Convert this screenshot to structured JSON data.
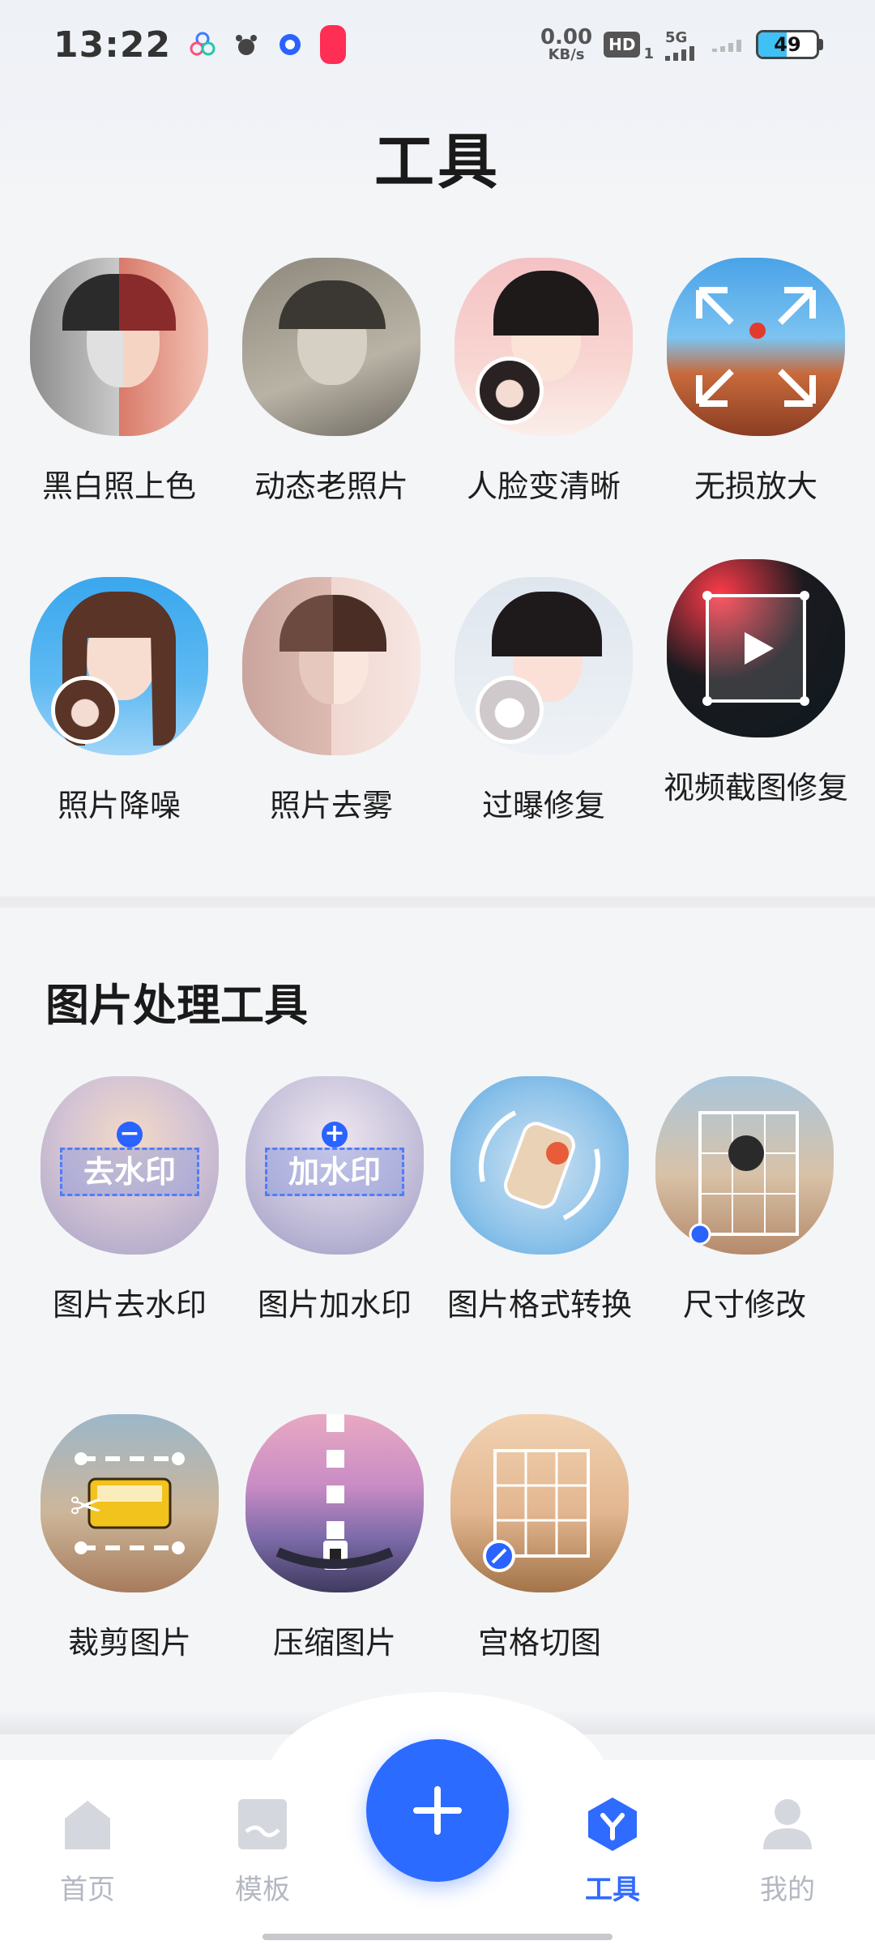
{
  "status_bar": {
    "time": "13:22",
    "net_speed_value": "0.00",
    "net_speed_unit": "KB/s",
    "hd_label": "HD",
    "hd_sub": "1",
    "network_label": "5G",
    "battery_level": "49",
    "battery_fraction": 0.49,
    "icons": [
      "flower-app-icon",
      "paw-app-icon",
      "target-app-icon",
      "screen-record-icon",
      "signal-icon"
    ]
  },
  "header": {
    "title": "工具"
  },
  "repair_section": {
    "tools": [
      {
        "label": "黑白照上色",
        "icon": "colorize-thumbnail"
      },
      {
        "label": "动态老照片",
        "icon": "animate-photo-thumbnail"
      },
      {
        "label": "人脸变清晰",
        "icon": "face-enhance-thumbnail"
      },
      {
        "label": "无损放大",
        "icon": "upscale-thumbnail"
      },
      {
        "label": "照片降噪",
        "icon": "denoise-thumbnail"
      },
      {
        "label": "照片去雾",
        "icon": "dehaze-thumbnail"
      },
      {
        "label": "过曝修复",
        "icon": "overexposure-thumbnail"
      },
      {
        "label": "视频截图修复",
        "icon": "video-frame-thumbnail"
      }
    ]
  },
  "processing_section": {
    "title": "图片处理工具",
    "tools": [
      {
        "label": "图片去水印",
        "overlay": "去水印",
        "icon": "remove-watermark-thumbnail"
      },
      {
        "label": "图片加水印",
        "overlay": "加水印",
        "icon": "add-watermark-thumbnail"
      },
      {
        "label": "图片格式转换",
        "icon": "format-convert-thumbnail"
      },
      {
        "label": "尺寸修改",
        "icon": "resize-thumbnail"
      },
      {
        "label": "裁剪图片",
        "icon": "crop-thumbnail"
      },
      {
        "label": "压缩图片",
        "icon": "compress-thumbnail"
      },
      {
        "label": "宫格切图",
        "icon": "grid-cut-thumbnail"
      }
    ]
  },
  "bottom_nav": {
    "items": [
      {
        "label": "首页",
        "icon": "home-icon",
        "active": false
      },
      {
        "label": "模板",
        "icon": "template-icon",
        "active": false
      },
      {
        "label": "工具",
        "icon": "tools-icon",
        "active": true
      },
      {
        "label": "我的",
        "icon": "profile-icon",
        "active": false
      }
    ],
    "fab_icon": "plus-icon"
  },
  "colors": {
    "accent": "#2b6bff",
    "nav_inactive": "#b3b8c2",
    "background": "#f4f5f7"
  }
}
